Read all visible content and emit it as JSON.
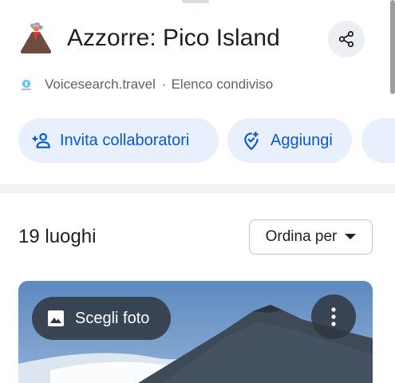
{
  "header": {
    "title": "Azzorre: Pico Island",
    "source_name": "Voicesearch.travel",
    "separator": "·",
    "list_type": "Elenco condiviso",
    "title_icon": "volcano-icon",
    "share_icon": "share-icon"
  },
  "actions": {
    "invite_label": "Invita collaboratori",
    "invite_icon": "person-add-icon",
    "add_label": "Aggiungi",
    "add_icon": "add-location-icon"
  },
  "places": {
    "count_label": "19 luoghi",
    "sort_label": "Ordina per",
    "sort_icon": "caret-down-icon"
  },
  "card": {
    "choose_photo_label": "Scegli foto",
    "photo_icon": "image-icon",
    "more_icon": "more-vert-icon"
  },
  "colors": {
    "accent": "#0b57d0",
    "chip_background": "#e8f0fe",
    "overlay_button": "#303740"
  }
}
